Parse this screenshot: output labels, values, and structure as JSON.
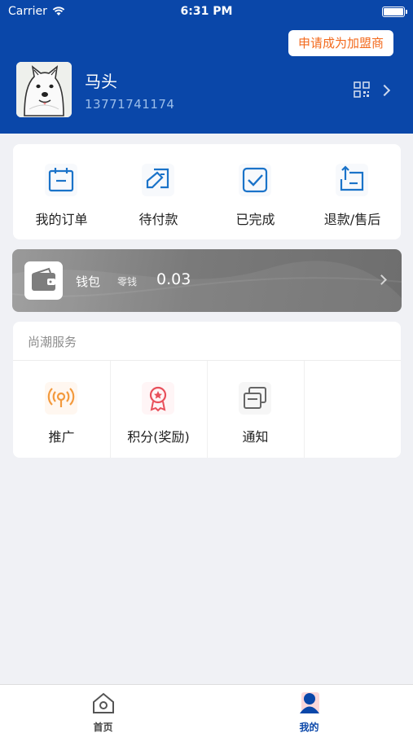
{
  "status_bar": {
    "carrier": "Carrier",
    "time": "6:31 PM"
  },
  "header": {
    "join_button": "申请成为加盟商",
    "username": "马头",
    "phone": "13771741174",
    "qr_icon": "qr-code-icon"
  },
  "orders": [
    {
      "label": "我的订单",
      "icon": "order-calendar-icon"
    },
    {
      "label": "待付款",
      "icon": "pending-payment-icon"
    },
    {
      "label": "已完成",
      "icon": "completed-check-icon"
    },
    {
      "label": "退款/售后",
      "icon": "refund-icon"
    }
  ],
  "wallet": {
    "label": "钱包",
    "change_label": "零钱",
    "change_value": "0.03"
  },
  "services": {
    "title": "尚潮服务",
    "items": [
      {
        "label": "推广",
        "icon": "broadcast-icon"
      },
      {
        "label": "积分(奖励)",
        "icon": "badge-icon"
      },
      {
        "label": "通知",
        "icon": "notification-icon"
      }
    ]
  },
  "tabbar": [
    {
      "label": "首页",
      "icon": "home-icon",
      "active": false
    },
    {
      "label": "我的",
      "icon": "profile-icon",
      "active": true
    }
  ],
  "colors": {
    "brand": "#0a47a9",
    "accent": "#f36a1d",
    "icon_blue": "#1a73c9"
  }
}
